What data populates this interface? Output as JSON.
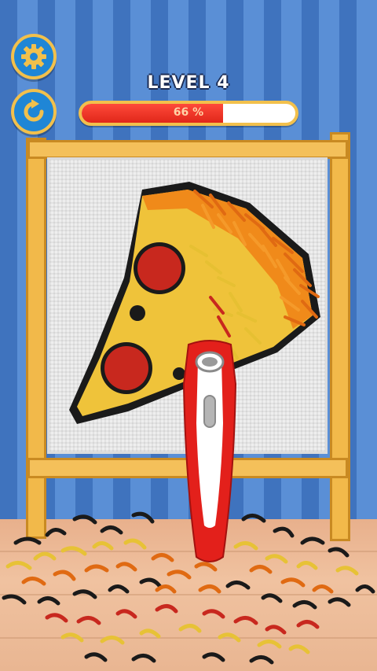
{
  "hud": {
    "level_label": "LEVEL 4",
    "progress_percent": 66,
    "progress_text": "66 %"
  },
  "buttons": {
    "settings_icon": "gear-icon",
    "restart_icon": "restart-icon"
  },
  "scene": {
    "artwork": "pizza-slice",
    "tool": "hair-clipper"
  },
  "colors": {
    "accent_gold": "#f2c04c",
    "button_blue": "#1f86d6",
    "progress_red": "#e0271a",
    "wall_blue": "#4a7fc8",
    "clipper_red": "#e3201b"
  }
}
